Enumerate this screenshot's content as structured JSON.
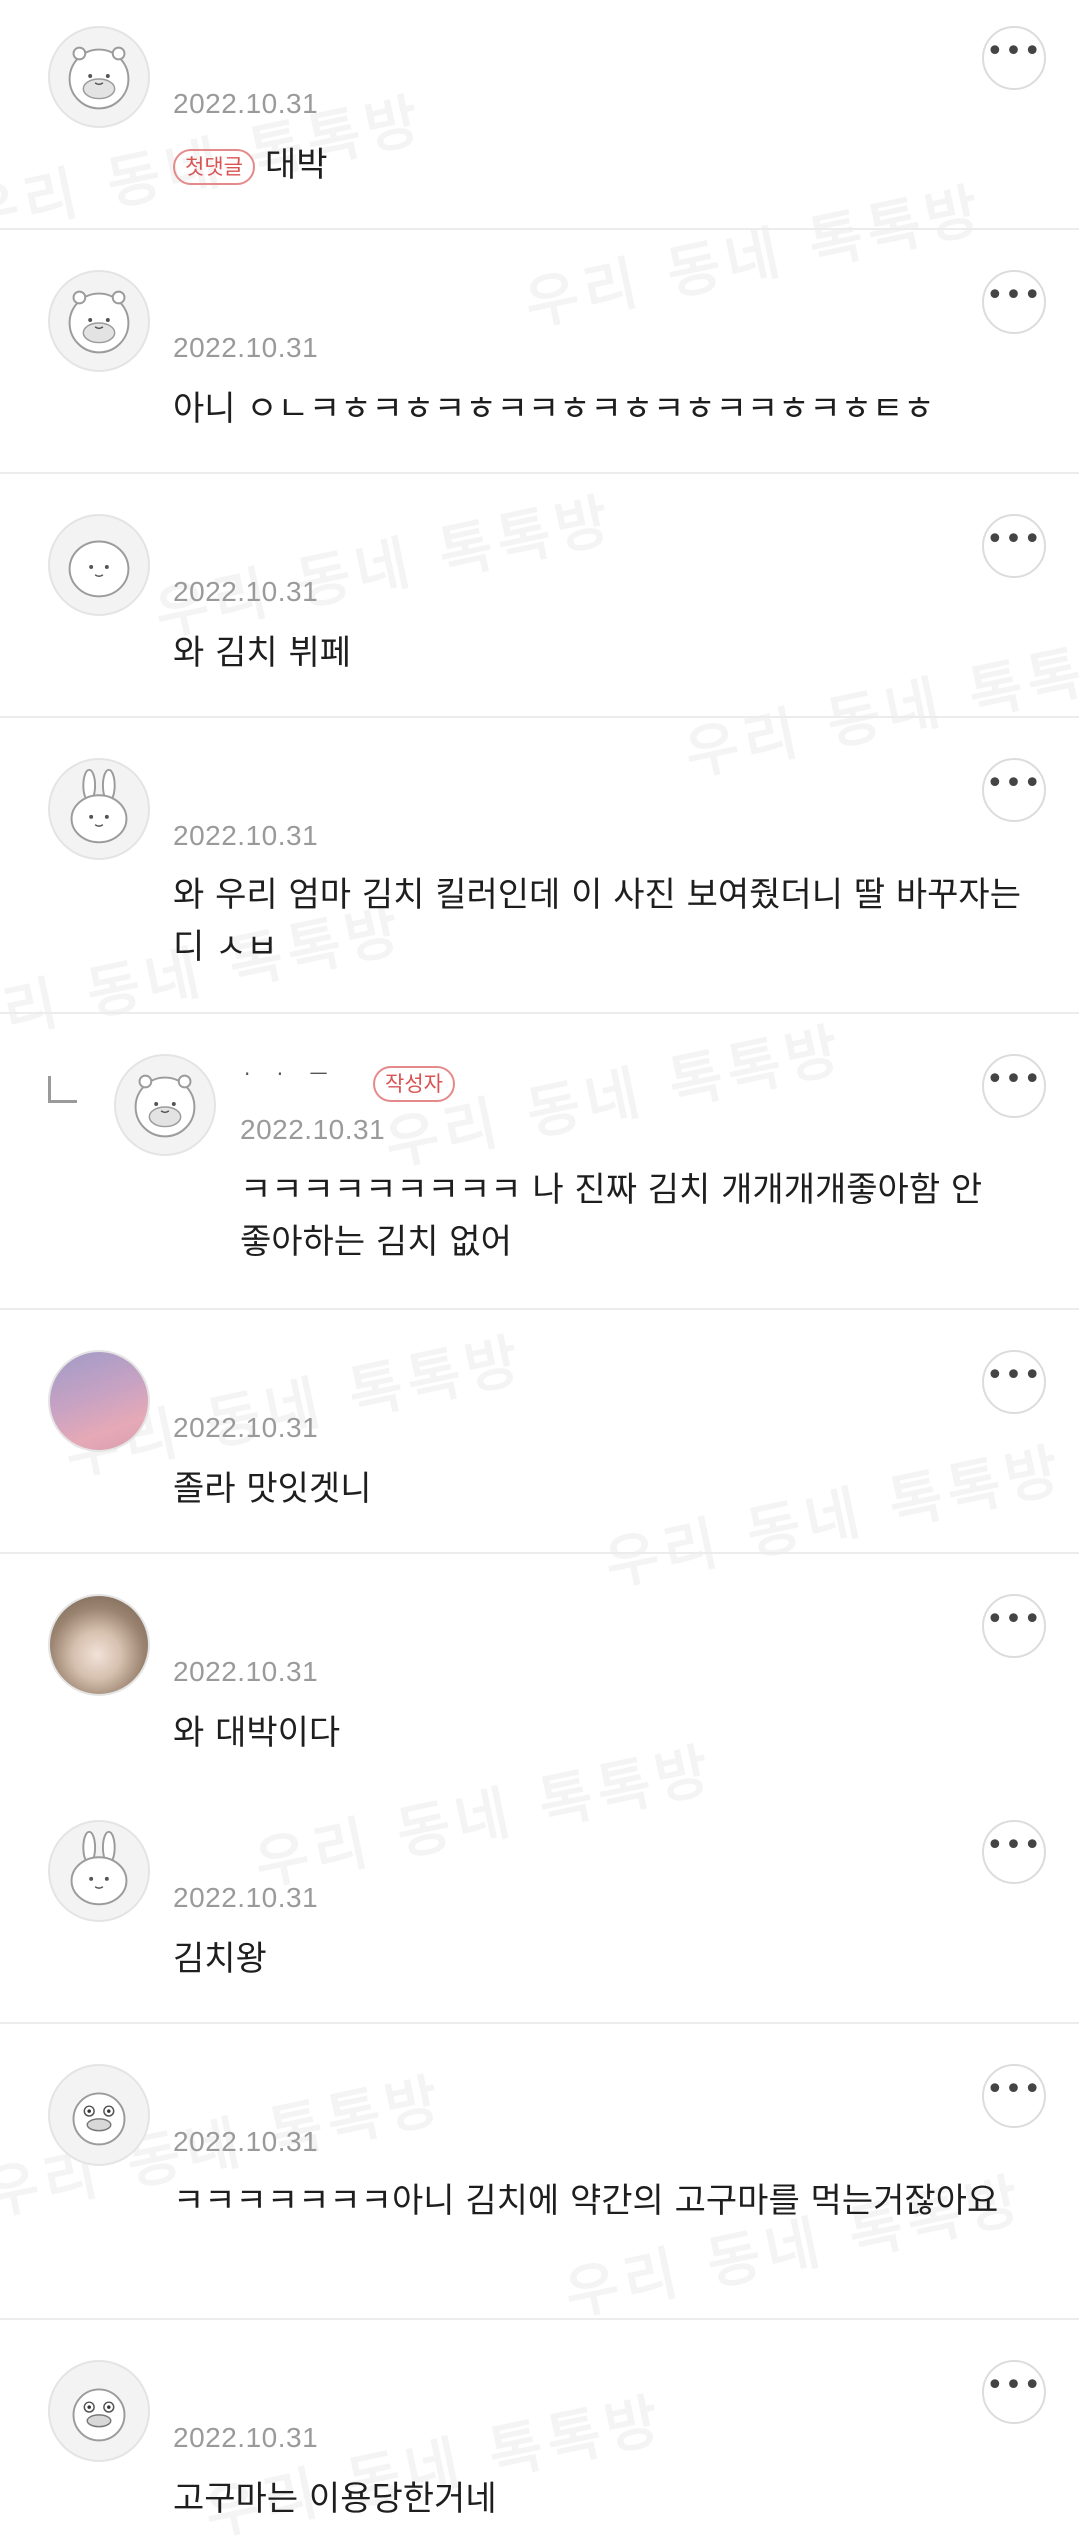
{
  "watermark_text": "우리 동네 톡톡방",
  "more_icon_glyph": "•••",
  "comments": [
    {
      "avatar": "hamster-icon",
      "date": "2022.10.31",
      "badge": "첫댓글",
      "text": "대박"
    },
    {
      "avatar": "hamster-icon",
      "date": "2022.10.31",
      "text": "아니 ㅇㄴㅋㅎㅋㅎㅋㅎㅋㅋㅎㅋㅎㅋㅎㅋㅋㅎㅋㅎㅌㅎ"
    },
    {
      "avatar": "round-character-icon",
      "date": "2022.10.31",
      "text": "와 김치 뷔페"
    },
    {
      "avatar": "rabbit-icon",
      "date": "2022.10.31",
      "text": "와 우리 엄마 김치 킬러인데 이 사진 보여줬더니 딸 바꾸자는디 ㅅㅂ"
    },
    {
      "avatar": "hamster-icon",
      "date": "2022.10.31",
      "is_reply": true,
      "nickname": "· · ㅡ",
      "author_badge": "작성자",
      "text": "ㅋㅋㅋㅋㅋㅋㅋㅋㅋ 나 진짜 김치 개개개개좋아함 안 좋아하는 김치 없어"
    },
    {
      "avatar": "sky-photo",
      "date": "2022.10.31",
      "text": "졸라 맛잇겟니"
    },
    {
      "avatar": "cat-photo",
      "date": "2022.10.31",
      "text": "와 대박이다"
    },
    {
      "avatar": "rabbit-icon",
      "date": "2022.10.31",
      "text": "김치왕"
    },
    {
      "avatar": "duck-icon",
      "date": "2022.10.31",
      "text": "ㅋㅋㅋㅋㅋㅋㅋ아니 김치에 약간의 고구마를 먹는거잖아요"
    },
    {
      "avatar": "duck-icon",
      "date": "2022.10.31",
      "text": "고구마는 이용당한거네"
    }
  ]
}
